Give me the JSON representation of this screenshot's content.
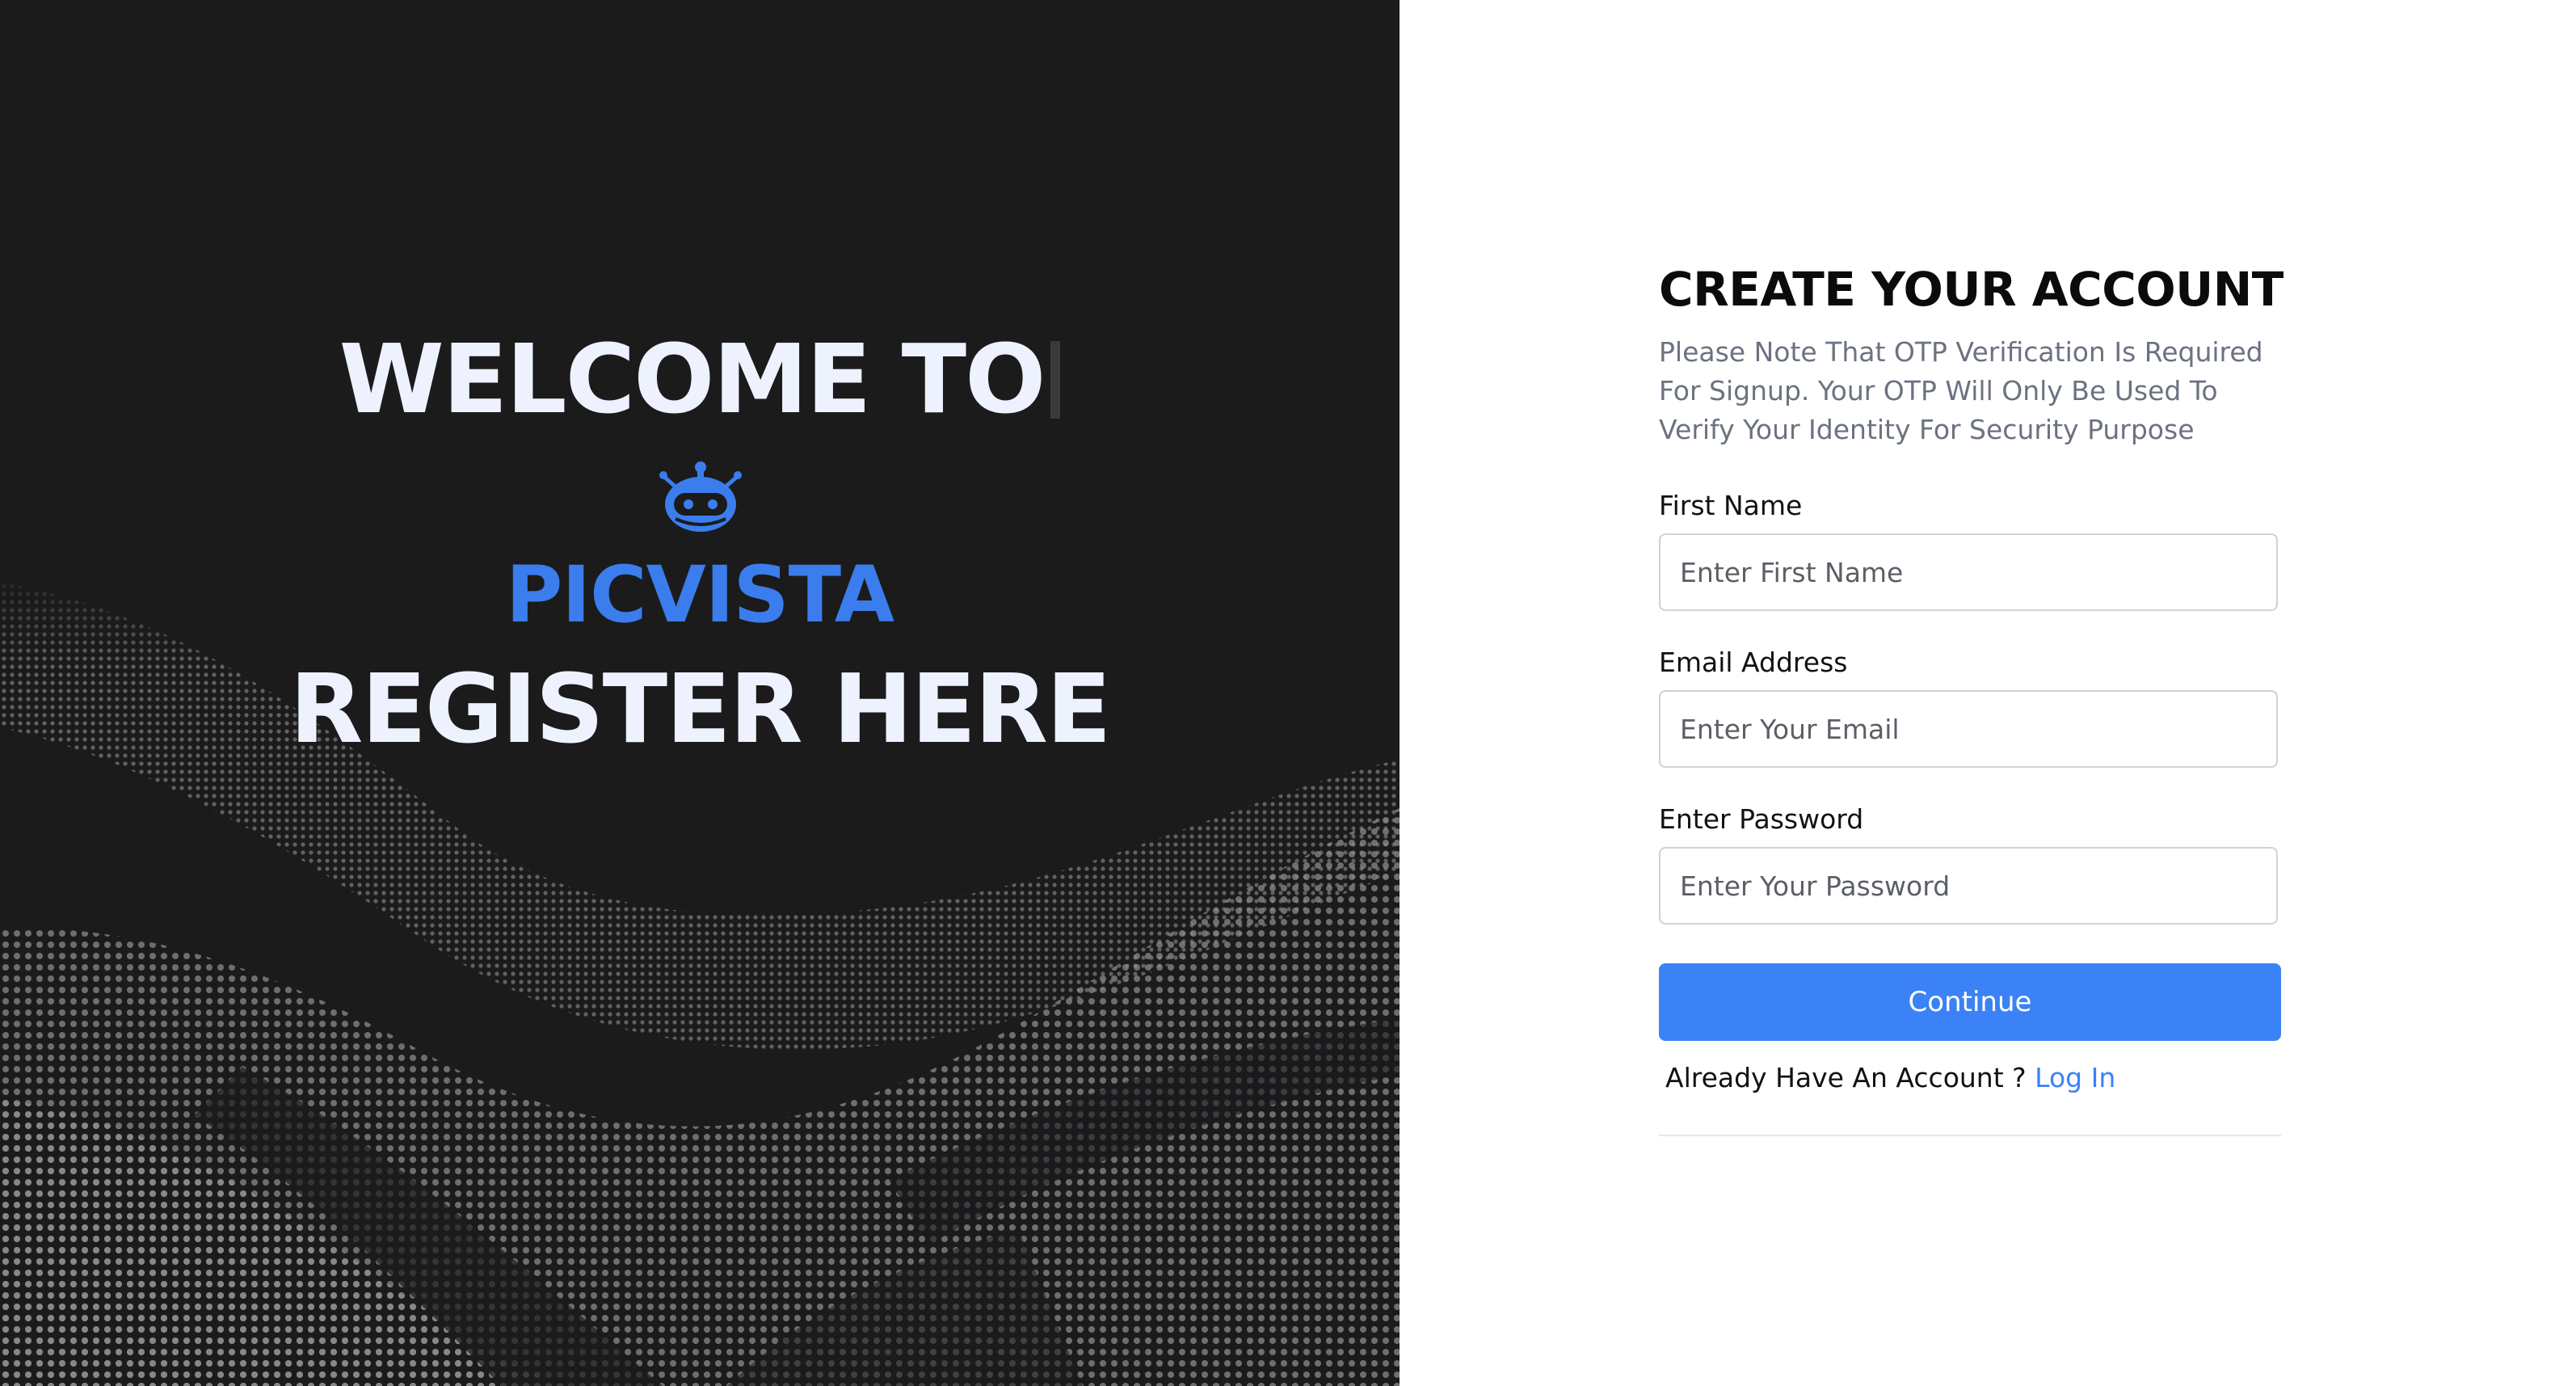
{
  "hero": {
    "welcome": "WELCOME TO",
    "brand": "PICVISTA",
    "tagline": "REGISTER HERE",
    "logo_icon": "robot-icon",
    "colors": {
      "background": "#1b1b1c",
      "heading": "#eef2ff",
      "brand": "#3b7ded"
    }
  },
  "form": {
    "title": "CREATE YOUR ACCOUNT",
    "note": "Please Note That OTP Verification Is Required For Signup. Your OTP Will Only Be Used To Verify Your Identity For Security Purpose",
    "first_name": {
      "label": "First Name",
      "placeholder": "Enter First Name",
      "value": ""
    },
    "email": {
      "label": "Email Address",
      "placeholder": "Enter Your Email",
      "value": ""
    },
    "password": {
      "label": "Enter Password",
      "placeholder": "Enter Your Password",
      "value": ""
    },
    "continue_label": "Continue",
    "login_prompt": "Already Have An Account ?",
    "login_link": "Log In",
    "colors": {
      "accent": "#3b82f6",
      "note_text": "#6b7280"
    }
  }
}
